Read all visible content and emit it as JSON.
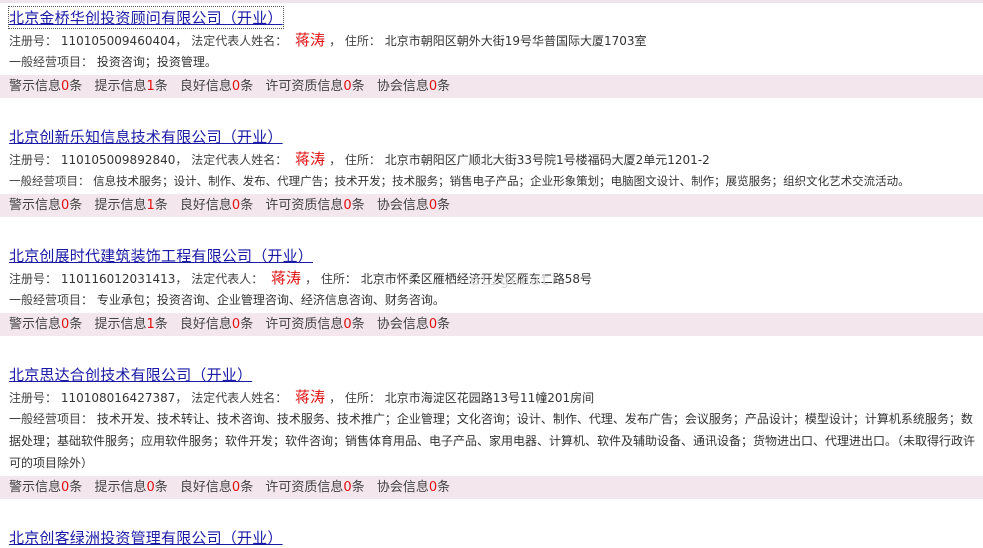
{
  "labels": {
    "reg_no": "注册号：",
    "legal_rep": "法定代表人姓名：",
    "legal_rep_short": "法定代表人：",
    "address": "住所：",
    "scope": "一般经营项目："
  },
  "companies": [
    {
      "name": "北京金桥华创投资顾问有限公司（开业）",
      "reg_no": "110105009460404",
      "legal_rep": "蒋涛",
      "address": "北京市朝阳区朝外大街19号华普国际大厦1703室",
      "scope": "投资咨询；投资管理。",
      "stats": {
        "warn": "0",
        "hint": "1",
        "good": "0",
        "license": "0",
        "assoc": "0"
      }
    },
    {
      "name": "北京创新乐知信息技术有限公司（开业）",
      "reg_no": "110105009892840",
      "legal_rep": "蒋涛",
      "address": "北京市朝阳区广顺北大街33号院1号楼福码大厦2单元1201-2",
      "scope": "信息技术服务；设计、制作、发布、代理广告；技术开发；技术服务；销售电子产品；企业形象策划；电脑图文设计、制作；展览服务；组织文化艺术交流活动。",
      "stats": {
        "warn": "0",
        "hint": "1",
        "good": "0",
        "license": "0",
        "assoc": "0"
      }
    },
    {
      "name": "北京创展时代建筑装饰工程有限公司（开业）",
      "reg_no": "110116012031413",
      "legal_rep": "蒋涛",
      "address": "北京市怀柔区雁栖经济开发区雁东二路58号",
      "scope": "专业承包；投资咨询、企业管理咨询、经济信息咨询、财务咨询。",
      "stats": {
        "warn": "0",
        "hint": "1",
        "good": "0",
        "license": "0",
        "assoc": "0"
      }
    },
    {
      "name": "北京思达合创技术有限公司（开业）",
      "reg_no": "110108016427387",
      "legal_rep": "蒋涛",
      "address": "北京市海淀区花园路13号11幢201房间",
      "scope": "技术开发、技术转让、技术咨询、技术服务、技术推广；企业管理；文化咨询；设计、制作、代理、发布广告；会议服务；产品设计；模型设计；计算机系统服务；数据处理；基础软件服务；应用软件服务；软件开发；软件咨询；销售体育用品、电子产品、家用电器、计算机、软件及辅助设备、通讯设备；货物进出口、代理进出口。（未取得行政许可的项目除外）",
      "stats": {
        "warn": "0",
        "hint": "0",
        "good": "0",
        "license": "0",
        "assoc": "0"
      }
    },
    {
      "name": "北京创客绿洲投资管理有限公司（开业）"
    }
  ],
  "stat_labels": {
    "warn": "警示信息",
    "hint": "提示信息",
    "good": "良好信息",
    "license": "许可资质信息",
    "assoc": "协会信息",
    "unit": "条"
  },
  "watermark": "etigerat"
}
